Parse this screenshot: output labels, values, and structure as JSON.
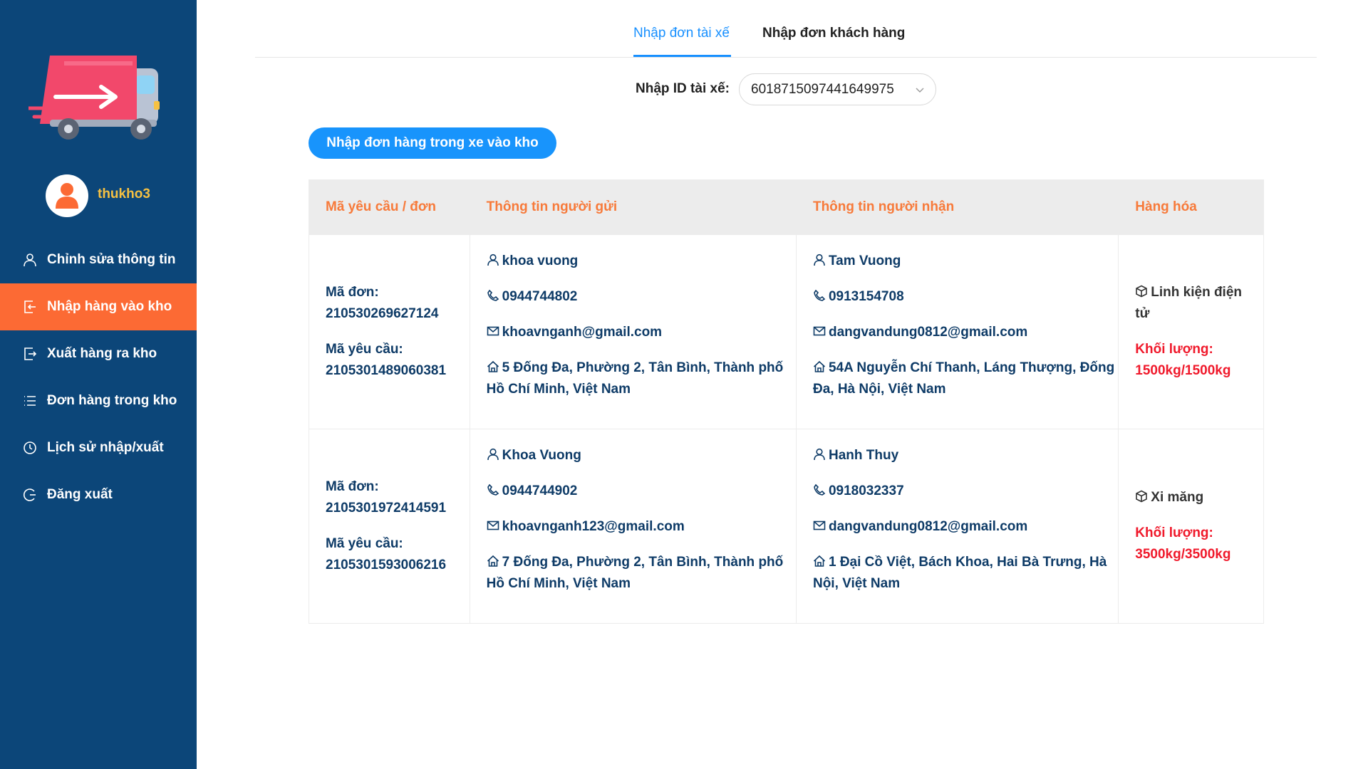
{
  "sidebar": {
    "username": "thukho3",
    "items": [
      {
        "label": "Chỉnh sửa thông tin",
        "icon": "user-icon"
      },
      {
        "label": "Nhập hàng vào kho",
        "icon": "import-icon"
      },
      {
        "label": "Xuất hàng ra kho",
        "icon": "export-icon"
      },
      {
        "label": "Đơn hàng trong kho",
        "icon": "list-icon"
      },
      {
        "label": "Lịch sử nhập/xuất",
        "icon": "history-icon"
      },
      {
        "label": "Đăng xuất",
        "icon": "logout-icon"
      }
    ],
    "active_index": 1,
    "active_color": "#fc6a34",
    "background": "#0c4679"
  },
  "tabs": [
    {
      "label": "Nhập đơn tài xế",
      "active": true
    },
    {
      "label": "Nhập đơn khách hàng",
      "active": false
    }
  ],
  "driver": {
    "label": "Nhập ID tài xế:",
    "value": "6018715097441649975"
  },
  "import_button": "Nhập đơn hàng trong xe vào kho",
  "table": {
    "headers": [
      "Mã yêu cầu / đơn",
      "Thông tin người gửi",
      "Thông tin người nhận",
      "Hàng hóa"
    ],
    "order_code_label": "Mã đơn:",
    "request_code_label": "Mã yêu cầu:",
    "weight_label": "Khối lượng:",
    "rows": [
      {
        "order_code": "210530269627124",
        "request_code": "2105301489060381",
        "sender": {
          "name": "khoa vuong",
          "phone": "0944744802",
          "email": "khoavnganh@gmail.com",
          "address": "5 Đống Đa, Phường 2, Tân Bình, Thành phố Hồ Chí Minh, Việt Nam"
        },
        "receiver": {
          "name": "Tam Vuong",
          "phone": "0913154708",
          "email": "dangvandung0812@gmail.com",
          "address": "54A Nguyễn Chí Thanh, Láng Thượng, Đống Đa, Hà Nội, Việt Nam"
        },
        "goods": {
          "name": "Linh kiện điện tử",
          "weight": "1500kg/1500kg"
        }
      },
      {
        "order_code": "2105301972414591",
        "request_code": "2105301593006216",
        "sender": {
          "name": "Khoa Vuong",
          "phone": "0944744902",
          "email": "khoavnganh123@gmail.com",
          "address": "7 Đống Đa, Phường 2, Tân Bình, Thành phố Hồ Chí Minh, Việt Nam"
        },
        "receiver": {
          "name": "Hanh Thuy",
          "phone": "0918032337",
          "email": "dangvandung0812@gmail.com",
          "address": "1 Đại Cồ Việt, Bách Khoa, Hai Bà Trưng, Hà Nội, Việt Nam"
        },
        "goods": {
          "name": "Xi măng",
          "weight": "3500kg/3500kg"
        }
      }
    ]
  }
}
